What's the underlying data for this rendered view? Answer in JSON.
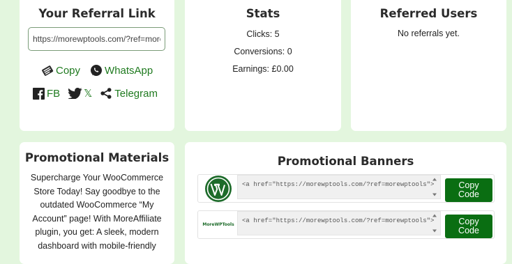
{
  "referral": {
    "title": "Your Referral Link",
    "link_value": "https://morewptools.com/?ref=morewptools",
    "copy_label": "Copy",
    "whatsapp_label": "WhatsApp",
    "fb_label": "FB",
    "x_label": "𝕏",
    "telegram_label": "Telegram"
  },
  "stats": {
    "title": "Stats",
    "clicks": "Clicks: 5",
    "conversions": "Conversions: 0",
    "earnings": "Earnings: £0.00"
  },
  "referred": {
    "title": "Referred Users",
    "empty_text": "No referrals yet."
  },
  "promo": {
    "title": "Promotional Materials",
    "text": "Supercharge Your WooCommerce Store Today! Say goodbye to the outdated WooCommerce “My Account” page! With MoreAffiliate plugin, you get: A sleek, modern dashboard with mobile-friendly"
  },
  "banners": {
    "title": "Promotional Banners",
    "items": [
      {
        "logo": "wordpress-logo",
        "code": "<a href=\"https://morewptools.com/?ref=morewptools\">",
        "button": "Copy Code"
      },
      {
        "logo": "MoreWPTools",
        "code": "<a href=\"https://morewptools.com/?ref=morewptools\">",
        "button": "Copy Code"
      }
    ]
  },
  "colors": {
    "page_bg": "#e3f6de",
    "accent_green": "#1f7a1f",
    "button_green": "#0a6e12"
  },
  "icons": [
    "copy-icon",
    "whatsapp-icon",
    "facebook-icon",
    "twitter-icon",
    "share-icon",
    "wordpress-logo-icon",
    "scroll-up-icon",
    "scroll-down-icon"
  ]
}
